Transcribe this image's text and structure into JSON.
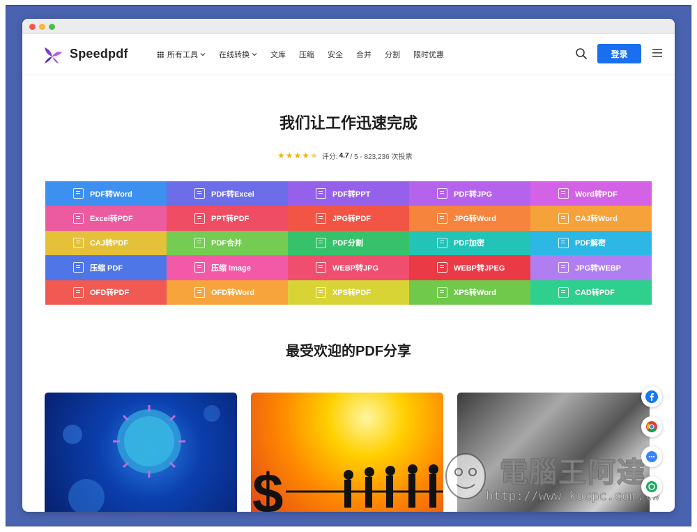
{
  "brand": {
    "name": "Speedpdf"
  },
  "nav": {
    "items": [
      {
        "label": "所有工具",
        "has_caret": true,
        "icon": "grid-icon"
      },
      {
        "label": "在线转换",
        "has_caret": true
      },
      {
        "label": "文库"
      },
      {
        "label": "压缩"
      },
      {
        "label": "安全"
      },
      {
        "label": "合并"
      },
      {
        "label": "分割"
      },
      {
        "label": "限时优惠"
      }
    ],
    "login_label": "登录",
    "accent": "#1a6ff0"
  },
  "hero": {
    "title": "我们让工作迅速完成",
    "rating_prefix": "评分:",
    "rating_value": "4.7",
    "rating_suffix": "/ 5 - 823,236 次投票",
    "stars": 4.5
  },
  "tools": [
    {
      "label": "PDF转Word",
      "color": "#3d8ff0"
    },
    {
      "label": "PDF转Excel",
      "color": "#6c6de9"
    },
    {
      "label": "PDF转PPT",
      "color": "#9561ea"
    },
    {
      "label": "PDF转JPG",
      "color": "#b562ec"
    },
    {
      "label": "Word转PDF",
      "color": "#d462e6"
    },
    {
      "label": "Excel转PDF",
      "color": "#ec5aa0"
    },
    {
      "label": "PPT转PDF",
      "color": "#ee4d63"
    },
    {
      "label": "JPG转PDF",
      "color": "#f25546"
    },
    {
      "label": "JPG转Word",
      "color": "#f7843d"
    },
    {
      "label": "CAJ转Word",
      "color": "#f6a23a"
    },
    {
      "label": "CAJ转PDF",
      "color": "#e5c13a"
    },
    {
      "label": "PDF合并",
      "color": "#74cc52"
    },
    {
      "label": "PDF分割",
      "color": "#36c26a"
    },
    {
      "label": "PDF加密",
      "color": "#23c4b8"
    },
    {
      "label": "PDF解密",
      "color": "#2db7e4"
    },
    {
      "label": "压缩 PDF",
      "color": "#4e76e6"
    },
    {
      "label": "压缩 Image",
      "color": "#f25aa8"
    },
    {
      "label": "WEBP转JPG",
      "color": "#f04e6e"
    },
    {
      "label": "WEBP转JPEG",
      "color": "#ea3a46"
    },
    {
      "label": "JPG转WEBP",
      "color": "#b07ef0"
    },
    {
      "label": "OFD转PDF",
      "color": "#f05a52"
    },
    {
      "label": "OFD转Word",
      "color": "#f8a43c"
    },
    {
      "label": "XPS转PDF",
      "color": "#d9d435"
    },
    {
      "label": "XPS转Word",
      "color": "#70c94a"
    },
    {
      "label": "CAD转PDF",
      "color": "#2fcf8e"
    }
  ],
  "shares": {
    "title": "最受欢迎的PDF分享"
  },
  "social": [
    "facebook-icon",
    "chrome-icon",
    "messenger-icon",
    "link-icon"
  ],
  "watermark": {
    "title": "電腦王阿達",
    "url": "http://www.kocpc.com.tw"
  }
}
